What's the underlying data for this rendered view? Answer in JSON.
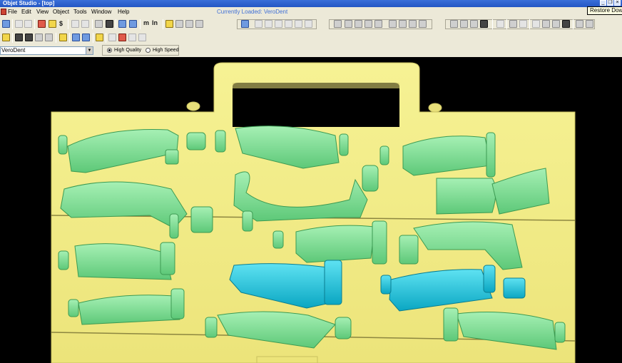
{
  "window": {
    "title": "Objet Studio - [top]",
    "restore_tooltip": "Restore Down"
  },
  "menu": {
    "items": [
      "File",
      "Edit",
      "View",
      "Object",
      "Tools",
      "Window",
      "Help"
    ],
    "currently_loaded": "Currently Loaded: VeroDent"
  },
  "material": {
    "selected": "VeroDent"
  },
  "quality": {
    "high_quality_label": "High Quality",
    "high_speed_label": "High Speed",
    "selected": "High Quality"
  },
  "toolbar_glyphs": {
    "dollar": "$",
    "m": "m",
    "ln": "ln"
  },
  "tray": {
    "tray_color": "#f5f08c",
    "model_color": "#86e39a",
    "selected_color": "#18c8de"
  }
}
